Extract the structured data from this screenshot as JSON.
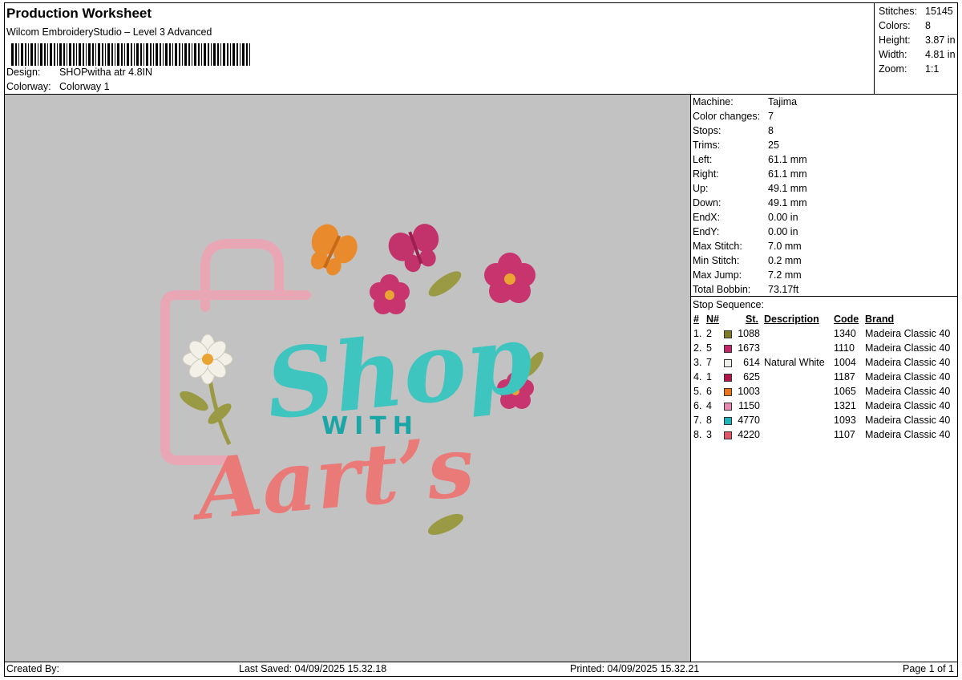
{
  "header": {
    "title": "Production Worksheet",
    "subtitle": "Wilcom EmbroideryStudio – Level 3 Advanced",
    "design_label": "Design:",
    "design_value": "SHOPwitha atr 4.8IN",
    "colorway_label": "Colorway:",
    "colorway_value": "Colorway 1"
  },
  "stats": [
    {
      "label": "Stitches:",
      "value": "15145"
    },
    {
      "label": "Colors:",
      "value": "8"
    },
    {
      "label": "Height:",
      "value": "3.87 in"
    },
    {
      "label": "Width:",
      "value": "4.81 in"
    },
    {
      "label": "Zoom:",
      "value": "1:1"
    }
  ],
  "machine": [
    {
      "label": "Machine:",
      "value": "Tajima"
    },
    {
      "label": "Color changes:",
      "value": "7"
    },
    {
      "label": "Stops:",
      "value": "8"
    },
    {
      "label": "Trims:",
      "value": "25"
    },
    {
      "label": "Left:",
      "value": "61.1 mm"
    },
    {
      "label": "Right:",
      "value": "61.1 mm"
    },
    {
      "label": "Up:",
      "value": "49.1 mm"
    },
    {
      "label": "Down:",
      "value": "49.1 mm"
    },
    {
      "label": "EndX:",
      "value": "0.00 in"
    },
    {
      "label": "EndY:",
      "value": "0.00 in"
    },
    {
      "label": "Max Stitch:",
      "value": "7.0 mm"
    },
    {
      "label": "Min Stitch:",
      "value": "0.2 mm"
    },
    {
      "label": "Max Jump:",
      "value": "7.2 mm"
    },
    {
      "label": "Total Bobbin:",
      "value": "73.17ft"
    }
  ],
  "sequence": {
    "title": "Stop Sequence:",
    "headers": {
      "num": "#",
      "n": "N#",
      "st": "St.",
      "description": "Description",
      "code": "Code",
      "brand": "Brand"
    },
    "rows": [
      {
        "num": "1.",
        "n": "2",
        "color": "#7e7a25",
        "st": "1088",
        "description": "",
        "code": "1340",
        "brand": "Madeira Classic 40"
      },
      {
        "num": "2.",
        "n": "5",
        "color": "#c2266a",
        "st": "1673",
        "description": "",
        "code": "1110",
        "brand": "Madeira Classic 40"
      },
      {
        "num": "3.",
        "n": "7",
        "color": "#f0f0ea",
        "st": "614",
        "description": "Natural White",
        "code": "1004",
        "brand": "Madeira Classic 40"
      },
      {
        "num": "4.",
        "n": "1",
        "color": "#b3144a",
        "st": "625",
        "description": "",
        "code": "1187",
        "brand": "Madeira Classic 40"
      },
      {
        "num": "5.",
        "n": "6",
        "color": "#e8741c",
        "st": "1003",
        "description": "",
        "code": "1065",
        "brand": "Madeira Classic 40"
      },
      {
        "num": "6.",
        "n": "4",
        "color": "#e68ab4",
        "st": "1150",
        "description": "",
        "code": "1321",
        "brand": "Madeira Classic 40"
      },
      {
        "num": "7.",
        "n": "8",
        "color": "#1fb5b8",
        "st": "4770",
        "description": "",
        "code": "1093",
        "brand": "Madeira Classic 40"
      },
      {
        "num": "8.",
        "n": "3",
        "color": "#e0576a",
        "st": "4220",
        "description": "",
        "code": "1107",
        "brand": "Madeira Classic 40"
      }
    ]
  },
  "design_art": {
    "word1": "Shop",
    "word2": "WITH",
    "word3": "Aart’s",
    "colors": {
      "bag": "#e9a7b6",
      "shop": "#3fc5c0",
      "with": "#1aa5a6",
      "aarts": "#ea7a78",
      "butterfly_orange": "#e98a2c",
      "butterfly_pink": "#c2336c",
      "flower_pink": "#c8356e",
      "leaf": "#9a9a45",
      "daisy": "#f3f0e8"
    }
  },
  "footer": {
    "created_by": "Created By:",
    "last_saved": "Last Saved: 04/09/2025 15.32.18",
    "printed": "Printed: 04/09/2025 15.32.21",
    "page": "Page 1 of 1"
  }
}
